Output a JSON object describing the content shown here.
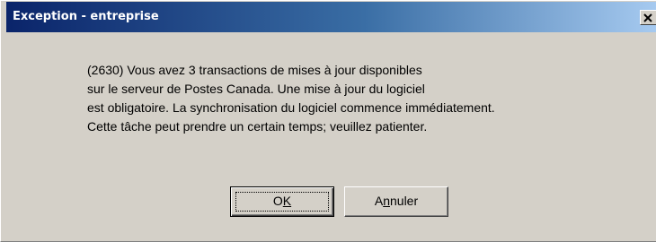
{
  "window": {
    "title": "Exception - entreprise",
    "close_glyph": "X"
  },
  "message": {
    "lines": [
      "(2630) Vous avez 3 transactions de mises à jour disponibles",
      "sur le serveur de Postes Canada. Une mise à jour du logiciel",
      "est obligatoire. La synchronisation du logiciel commence immédiatement.",
      "Cette tâche peut prendre un certain temps; veuillez patienter."
    ]
  },
  "buttons": {
    "ok": {
      "label_before": "O",
      "label_mnemonic": "K",
      "label_after": ""
    },
    "cancel": {
      "label_before": "A",
      "label_mnemonic": "n",
      "label_after": "nuler"
    }
  },
  "colors": {
    "titlebar_start": "#0a246a",
    "titlebar_end": "#a6caf0",
    "dialog_bg": "#d4d0c8"
  }
}
